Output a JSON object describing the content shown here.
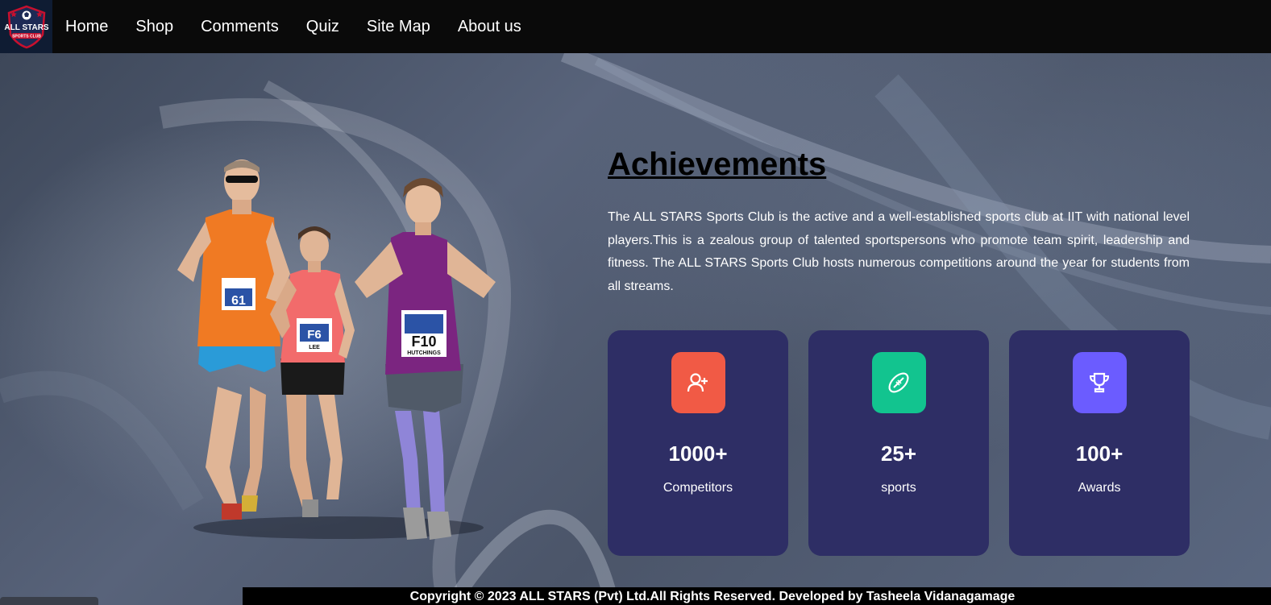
{
  "logo": {
    "text_top": "ALL STARS",
    "text_bottom": "SPORTS CLUB"
  },
  "nav": {
    "items": [
      {
        "label": "Home"
      },
      {
        "label": "Shop"
      },
      {
        "label": "Comments"
      },
      {
        "label": "Quiz"
      },
      {
        "label": "Site Map"
      },
      {
        "label": "About us"
      }
    ]
  },
  "hero": {
    "runners": {
      "bib_left": "61",
      "bib_middle": "F6",
      "bib_middle_name": "LEE",
      "bib_right": "F10",
      "bib_right_name": "HUTCHINGS"
    }
  },
  "achievements": {
    "title": "Achievements",
    "description": "The ALL STARS Sports Club is the active and a well-established sports club at IIT with national level players.This is a zealous group of talented sportspersons who promote team spirit, leadership and fitness. The ALL STARS Sports Club hosts numerous competitions around the year for students from all streams.",
    "stats": [
      {
        "value": "1000+",
        "label": "Competitors",
        "icon": "add-user-icon",
        "color": "#f15a45"
      },
      {
        "value": "25+",
        "label": "sports",
        "icon": "football-icon",
        "color": "#12c48f"
      },
      {
        "value": "100+",
        "label": "Awards",
        "icon": "trophy-icon",
        "color": "#6b5cff"
      }
    ]
  },
  "footer": {
    "text": "Copyright © 2023 ALL STARS (Pvt) Ltd.All Rights Reserved. Developed by Tasheela Vidanagamage"
  },
  "colors": {
    "navbar": "#0a0a0a",
    "card": "#2e2e65",
    "footer": "#000000"
  }
}
